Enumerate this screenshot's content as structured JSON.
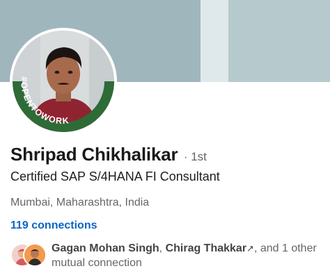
{
  "profile": {
    "name": "Shripad Chikhalikar",
    "degree": "· 1st",
    "headline": "Certified SAP S/4HANA FI Consultant",
    "location": "Mumbai, Maharashtra, India",
    "connections": "119 connections",
    "open_to_work_badge": "#OPENTOWORK"
  },
  "mutual": {
    "name1": "Gagan Mohan Singh",
    "separator": ", ",
    "name2": "Chirag Thakkar",
    "ext_icon": "↗",
    "rest": ", and 1 other mutual connection"
  },
  "colors": {
    "connections_link": "#0a66c2",
    "open_to_work_green": "#2e6b37"
  }
}
